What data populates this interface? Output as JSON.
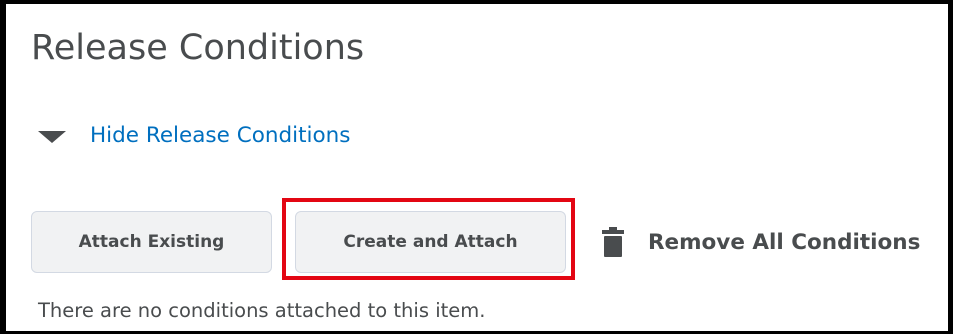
{
  "section": {
    "title": "Release Conditions"
  },
  "toggle": {
    "label": "Hide Release Conditions"
  },
  "actions": {
    "attach_existing_label": "Attach Existing",
    "create_and_attach_label": "Create and Attach",
    "remove_all_label": "Remove All Conditions"
  },
  "status": {
    "empty_message": "There are no conditions attached to this item."
  },
  "icons": {
    "toggle": "caret-down-icon",
    "remove": "trash-icon"
  },
  "colors": {
    "link": "#006fbf",
    "text": "#494c4e",
    "button_bg": "#f1f2f3",
    "highlight": "#e30613"
  }
}
